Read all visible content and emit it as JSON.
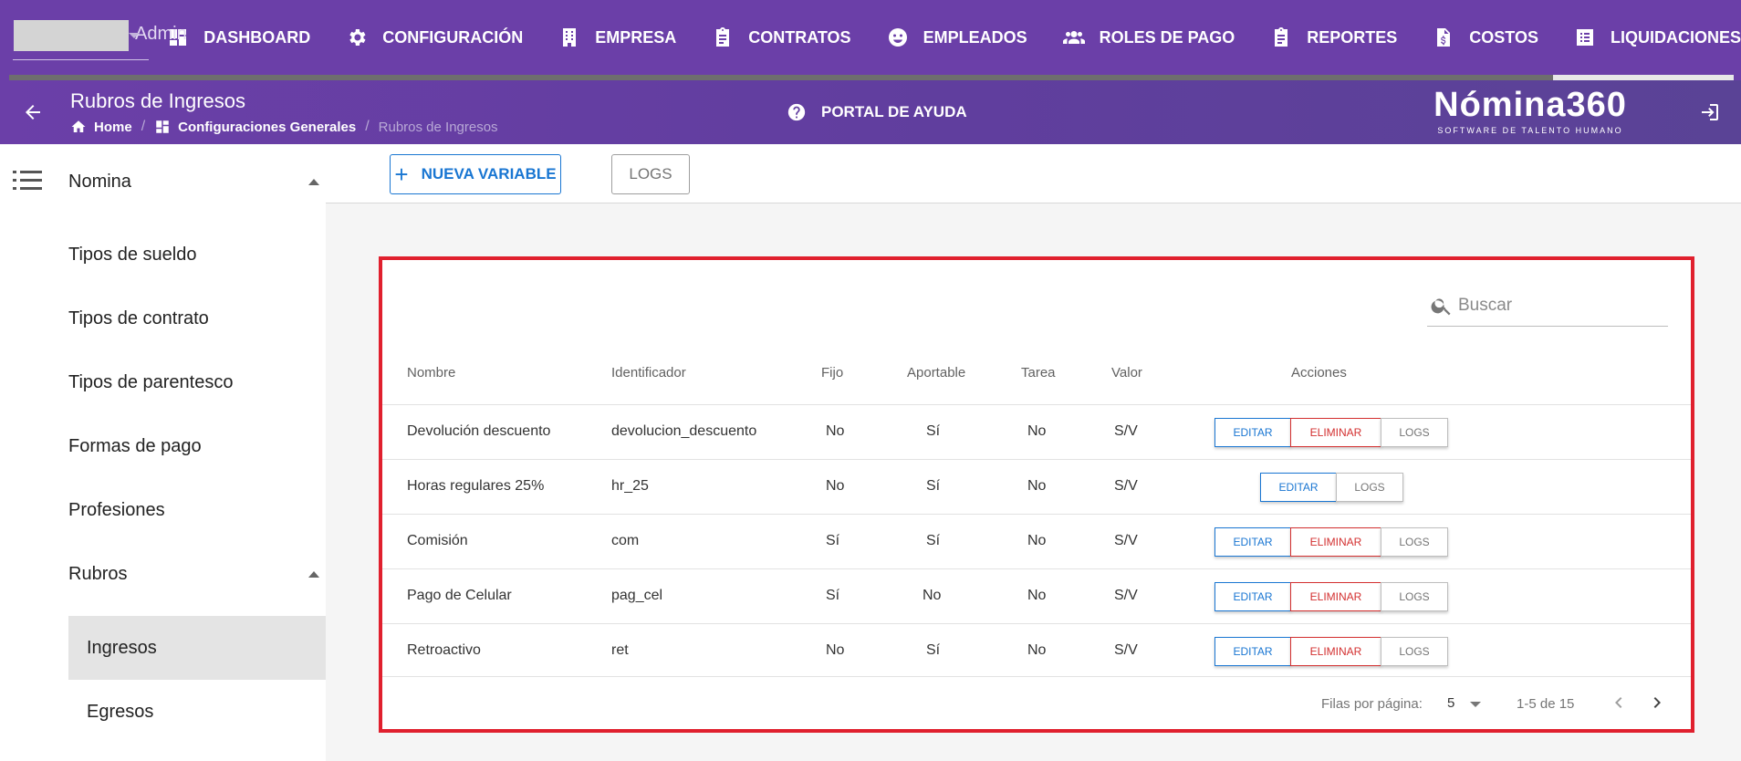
{
  "topbar": {
    "user_name": "Admin",
    "nav": [
      {
        "label": "DASHBOARD",
        "icon": "dashboard-icon"
      },
      {
        "label": "CONFIGURACIÓN",
        "icon": "gear-icon"
      },
      {
        "label": "EMPRESA",
        "icon": "building-icon"
      },
      {
        "label": "CONTRATOS",
        "icon": "clipboard-icon"
      },
      {
        "label": "EMPLEADOS",
        "icon": "face-icon"
      },
      {
        "label": "ROLES DE PAGO",
        "icon": "people-icon"
      },
      {
        "label": "REPORTES",
        "icon": "clipboard-icon"
      },
      {
        "label": "COSTOS",
        "icon": "document-dollar-icon"
      },
      {
        "label": "LIQUIDACIONES",
        "icon": "list-icon"
      }
    ],
    "active_nav": "LIQUIDACIONES"
  },
  "subheader": {
    "title": "Rubros de Ingresos",
    "breadcrumbs": {
      "home": "Home",
      "section": "Configuraciones Generales",
      "current": "Rubros de Ingresos"
    },
    "help_label": "PORTAL DE AYUDA",
    "logo_main": "Nómina360",
    "logo_sub": "SOFTWARE DE TALENTO HUMANO"
  },
  "sidebar": {
    "group1": "Nomina",
    "items": [
      "Tipos de sueldo",
      "Tipos de contrato",
      "Tipos de parentesco",
      "Formas de pago",
      "Profesiones"
    ],
    "group2": "Rubros",
    "sub_items": [
      "Ingresos",
      "Egresos"
    ],
    "active": "Ingresos"
  },
  "toolbar": {
    "new_label": "NUEVA VARIABLE",
    "logs_label": "LOGS"
  },
  "table": {
    "search_placeholder": "Buscar",
    "headers": {
      "nombre": "Nombre",
      "identificador": "Identificador",
      "fijo": "Fijo",
      "aportable": "Aportable",
      "tarea": "Tarea",
      "valor": "Valor",
      "acciones": "Acciones"
    },
    "action_labels": {
      "edit": "EDITAR",
      "delete": "ELIMINAR",
      "logs": "LOGS"
    },
    "rows": [
      {
        "nombre": "Devolución descuento",
        "identificador": "devolucion_descuento",
        "fijo": "No",
        "aportable": "Sí",
        "tarea": "No",
        "valor": "S/V",
        "deletable": true
      },
      {
        "nombre": "Horas regulares 25%",
        "identificador": "hr_25",
        "fijo": "No",
        "aportable": "Sí",
        "tarea": "No",
        "valor": "S/V",
        "deletable": false
      },
      {
        "nombre": "Comisión",
        "identificador": "com",
        "fijo": "Sí",
        "aportable": "Sí",
        "tarea": "No",
        "valor": "S/V",
        "deletable": true
      },
      {
        "nombre": "Pago de Celular",
        "identificador": "pag_cel",
        "fijo": "Sí",
        "aportable": "No",
        "tarea": "No",
        "valor": "S/V",
        "deletable": true
      },
      {
        "nombre": "Retroactivo",
        "identificador": "ret",
        "fijo": "No",
        "aportable": "Sí",
        "tarea": "No",
        "valor": "S/V",
        "deletable": true
      }
    ],
    "pagination": {
      "rows_label": "Filas por página:",
      "rows_per_page": "5",
      "range": "1-5 de 15"
    }
  },
  "colors": {
    "primary_purple": "#6b3fa8",
    "accent_blue": "#1976d2",
    "danger_red": "#d32f2f",
    "highlight_border": "#e0202e"
  }
}
